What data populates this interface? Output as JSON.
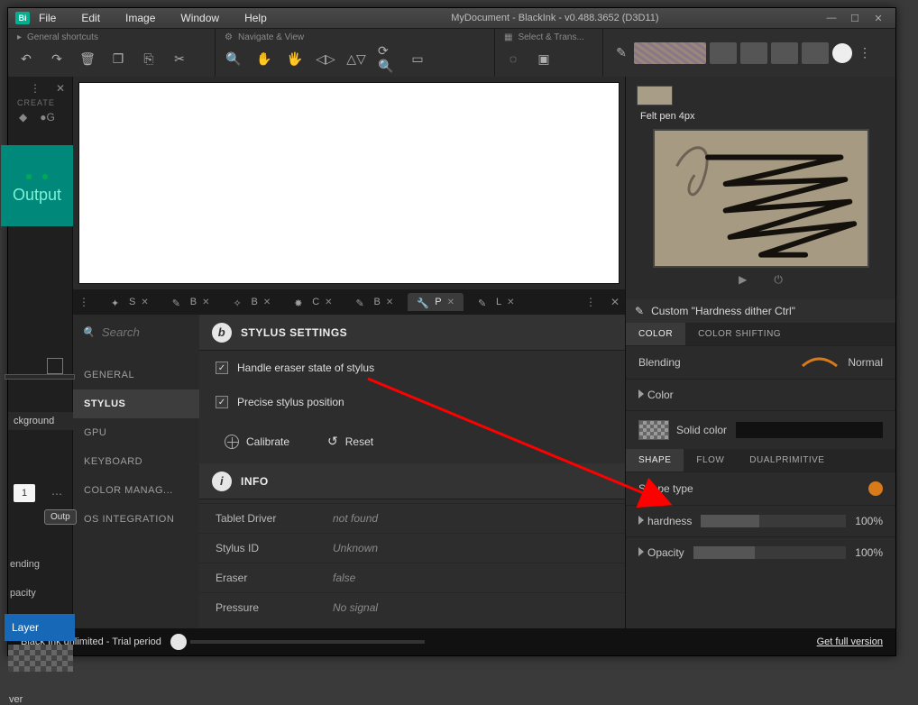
{
  "titlebar": {
    "logo": "Bi",
    "menus": [
      "File",
      "Edit",
      "Image",
      "Window",
      "Help"
    ],
    "title": "MyDocument - BlackInk  - v0.488.3652 (D3D11)"
  },
  "toolbar": {
    "groups": {
      "general": {
        "label": "General shortcuts"
      },
      "navigate": {
        "label": "Navigate & View"
      },
      "select": {
        "label": "Select & Trans..."
      }
    }
  },
  "left": {
    "create_label": "CREATE",
    "output_word": "Output",
    "ver_label": "ver",
    "kground": "ckground",
    "num_tab": "1",
    "outp_btn": "Outp",
    "ending": "ending",
    "pacity": "pacity",
    "layer": "Layer"
  },
  "tabs": {
    "items": [
      {
        "icon": "bone",
        "letter": "S"
      },
      {
        "icon": "brush",
        "letter": "B"
      },
      {
        "icon": "wand",
        "letter": "B"
      },
      {
        "icon": "spark",
        "letter": "C"
      },
      {
        "icon": "brush",
        "letter": "B"
      },
      {
        "icon": "wrench",
        "letter": "P",
        "active": true
      },
      {
        "icon": "pen",
        "letter": "L"
      }
    ]
  },
  "settings": {
    "search_placeholder": "Search",
    "title": "STYLUS SETTINGS",
    "nav": [
      "GENERAL",
      "STYLUS",
      "GPU",
      "KEYBOARD",
      "COLOR MANAG...",
      "OS INTEGRATION"
    ],
    "nav_selected": "STYLUS",
    "check1": "Handle eraser state of stylus",
    "check2": "Precise stylus position",
    "btn_calibrate": "Calibrate",
    "btn_reset": "Reset",
    "info_label": "INFO",
    "info_rows": [
      {
        "k": "Tablet Driver",
        "v": "not found"
      },
      {
        "k": "Stylus ID",
        "v": "Unknown"
      },
      {
        "k": "Eraser",
        "v": "false"
      },
      {
        "k": "Pressure",
        "v": "No signal"
      }
    ]
  },
  "right": {
    "felt_label": "Felt pen 4px",
    "custom_label": "Custom \"Hardness dither Ctrl\"",
    "tabs_top": [
      "COLOR",
      "COLOR SHIFTING"
    ],
    "blending": "Blending",
    "blend_mode": "Normal",
    "color_label": "Color",
    "solid_label": "Solid color",
    "tabs_mid": [
      "SHAPE",
      "FLOW",
      "DUALPRIMITIVE"
    ],
    "shape_type": "Shape type",
    "hardness": "hardness",
    "hardness_val": "100%",
    "opacity": "Opacity",
    "opacity_val": "100%"
  },
  "footer": {
    "trial": "Black Ink unlimited - Trial period",
    "full": "Get full version"
  }
}
